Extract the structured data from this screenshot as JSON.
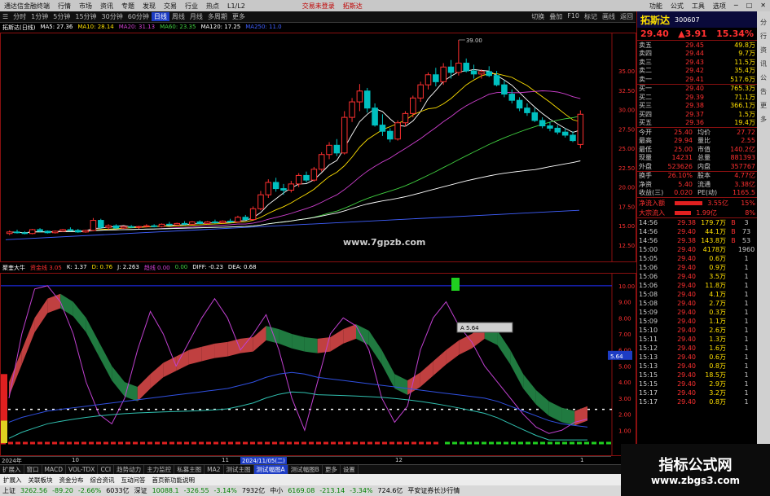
{
  "titlebar": {
    "app": "通达信金融终端",
    "menus": [
      "行情",
      "市场",
      "资讯",
      "专题",
      "发现",
      "交易",
      "行业",
      "热点",
      "L1/L2"
    ],
    "center_left": "交易未登录",
    "center_right": "拓斯达",
    "right": [
      "功能",
      "公式",
      "工具",
      "选项"
    ]
  },
  "toolbar": {
    "items": [
      "分时",
      "1分钟",
      "5分钟",
      "15分钟",
      "30分钟",
      "60分钟",
      "日线",
      "周线",
      "月线",
      "多周期",
      "更多"
    ],
    "active_index": 6,
    "right": [
      "切换",
      "叠加",
      "F10",
      "标记",
      "画线",
      "返回"
    ]
  },
  "ma_legend": [
    {
      "text": "拓斯达(日线)",
      "color": "#ffffff"
    },
    {
      "text": "MA5: 27.36",
      "color": "#ffffff"
    },
    {
      "text": "MA10: 28.14",
      "color": "#ffe000"
    },
    {
      "text": "MA20: 31.13",
      "color": "#d040d0"
    },
    {
      "text": "MA60: 23.35",
      "color": "#40d040"
    },
    {
      "text": "MA120: 17.25",
      "color": "#ffffff"
    },
    {
      "text": "MA250: 11.0",
      "color": "#4060ff"
    }
  ],
  "main_axis": [
    "35.00",
    "32.50",
    "30.00",
    "27.50",
    "25.00",
    "22.50",
    "20.00",
    "17.50",
    "15.00",
    "12.50"
  ],
  "high_label": "39.00",
  "watermark": "www.7gpzb.com",
  "indicator_legend": [
    {
      "text": "聚奎大牛",
      "color": "#ffffff"
    },
    {
      "text": "资金线 3.05",
      "color": "#ff3030"
    },
    {
      "text": "K: 1.37",
      "color": "#ffffff"
    },
    {
      "text": "D: 0.76",
      "color": "#ffe000"
    },
    {
      "text": "J: 2.263",
      "color": "#ffffff"
    },
    {
      "text": "趋线 0.00",
      "color": "#d040d0"
    },
    {
      "text": "0.00",
      "color": "#40d040"
    },
    {
      "text": "DIFF: -0.23",
      "color": "#ffffff"
    },
    {
      "text": "DEA: 0.68",
      "color": "#ffffff"
    }
  ],
  "ind_axis": [
    "10.00",
    "9.00",
    "8.00",
    "7.00",
    "6.00",
    "5.00",
    "4.00",
    "3.00",
    "2.00",
    "1.00"
  ],
  "ind_marker": "5.64",
  "tooltip": "A 5.64",
  "dates": [
    {
      "text": "2024年"
    },
    {
      "text": "10"
    },
    {
      "text": "11"
    },
    {
      "text": "2024/11/05(二)"
    },
    {
      "text": "12"
    },
    {
      "text": "1"
    }
  ],
  "panel": {
    "name": "拓斯达",
    "code": "300607",
    "price": "29.40",
    "change": "▲3.91",
    "pct": "15.34%",
    "asks": [
      {
        "l": "卖五",
        "p": "29.45",
        "v": "49.8万"
      },
      {
        "l": "卖四",
        "p": "29.44",
        "v": "9.7万"
      },
      {
        "l": "卖三",
        "p": "29.43",
        "v": "11.5万"
      },
      {
        "l": "卖二",
        "p": "29.42",
        "v": "35.4万"
      },
      {
        "l": "卖一",
        "p": "29.41",
        "v": "517.6万"
      }
    ],
    "bids": [
      {
        "l": "买一",
        "p": "29.40",
        "v": "765.3万"
      },
      {
        "l": "买二",
        "p": "29.39",
        "v": "71.1万"
      },
      {
        "l": "买三",
        "p": "29.38",
        "v": "366.1万"
      },
      {
        "l": "买四",
        "p": "29.37",
        "v": "1.5万"
      },
      {
        "l": "买五",
        "p": "29.36",
        "v": "19.4万"
      }
    ],
    "stats": [
      {
        "a": "今开",
        "b": "25.40",
        "c": "均价",
        "d": "27.72"
      },
      {
        "a": "最高",
        "b": "29.94",
        "c": "量比",
        "d": "2.55"
      },
      {
        "a": "最低",
        "b": "25.00",
        "c": "市值",
        "d": "140.2亿"
      },
      {
        "a": "现量",
        "b": "14231",
        "c": "总量",
        "d": "881393"
      },
      {
        "a": "外盘",
        "b": "523626",
        "c": "内盘",
        "d": "357767"
      }
    ],
    "stats2": [
      {
        "a": "换手",
        "b": "26.10%",
        "c": "股本",
        "d": "4.77亿"
      },
      {
        "a": "净资",
        "b": "5.40",
        "c": "流通",
        "d": "3.38亿"
      },
      {
        "a": "收益(三)",
        "b": "0.020",
        "c": "PE(动)",
        "d": "1165.5"
      }
    ],
    "flow": [
      {
        "l": "净流入额",
        "v": "3.55亿",
        "p": "15%",
        "w": 34
      },
      {
        "l": "大宗流入",
        "v": "1.99亿",
        "p": "8%",
        "w": 20
      }
    ],
    "ticks": [
      {
        "t": "14:56",
        "p": "29.38",
        "v": "179.7万",
        "f": "B",
        "n": "3"
      },
      {
        "t": "14:56",
        "p": "29.40",
        "v": "44.1万",
        "f": "B",
        "n": "73"
      },
      {
        "t": "14:56",
        "p": "29.38",
        "v": "143.8万",
        "f": "B",
        "n": "53"
      },
      {
        "t": "15:00",
        "p": "29.40",
        "v": "4178万",
        "f": "",
        "n": "1960"
      },
      {
        "t": "15:05",
        "p": "29.40",
        "v": "0.6万",
        "f": "",
        "n": "1"
      },
      {
        "t": "15:06",
        "p": "29.40",
        "v": "0.9万",
        "f": "",
        "n": "1"
      },
      {
        "t": "15:06",
        "p": "29.40",
        "v": "3.5万",
        "f": "",
        "n": "1"
      },
      {
        "t": "15:06",
        "p": "29.40",
        "v": "11.8万",
        "f": "",
        "n": "1"
      },
      {
        "t": "15:08",
        "p": "29.40",
        "v": "4.1万",
        "f": "",
        "n": "1"
      },
      {
        "t": "15:08",
        "p": "29.40",
        "v": "2.7万",
        "f": "",
        "n": "1"
      },
      {
        "t": "15:09",
        "p": "29.40",
        "v": "0.3万",
        "f": "",
        "n": "1"
      },
      {
        "t": "15:09",
        "p": "29.40",
        "v": "1.1万",
        "f": "",
        "n": "1"
      },
      {
        "t": "15:10",
        "p": "29.40",
        "v": "2.6万",
        "f": "",
        "n": "1"
      },
      {
        "t": "15:11",
        "p": "29.40",
        "v": "1.3万",
        "f": "",
        "n": "1"
      },
      {
        "t": "15:12",
        "p": "29.40",
        "v": "1.6万",
        "f": "",
        "n": "1"
      },
      {
        "t": "15:13",
        "p": "29.40",
        "v": "0.6万",
        "f": "",
        "n": "1"
      },
      {
        "t": "15:13",
        "p": "29.40",
        "v": "0.8万",
        "f": "",
        "n": "1"
      },
      {
        "t": "15:15",
        "p": "29.40",
        "v": "18.5万",
        "f": "",
        "n": "1"
      },
      {
        "t": "15:15",
        "p": "29.40",
        "v": "2.9万",
        "f": "",
        "n": "1"
      },
      {
        "t": "15:17",
        "p": "29.40",
        "v": "3.2万",
        "f": "",
        "n": "1"
      },
      {
        "t": "15:17",
        "p": "29.40",
        "v": "0.8万",
        "f": "",
        "n": "1"
      }
    ]
  },
  "sidebar": [
    "分",
    "行",
    "资",
    "讯",
    "公",
    "告",
    "更",
    "多"
  ],
  "tabs": [
    "扩展入",
    "窗口",
    "MACD",
    "VOL-TDX",
    "CCI",
    "趋势动力",
    "主力监控",
    "私募主图",
    "MA2",
    "测试主图",
    "测试幅图A",
    "测试幅图B",
    "更多",
    "设置"
  ],
  "tabs_active": 10,
  "infobar": [
    "扩展入",
    "关联板块",
    "资金分布",
    "综合资讯",
    "互动问答",
    "首页新功能说明"
  ],
  "statusbar": [
    {
      "text": "上证",
      "cls": ""
    },
    {
      "text": "3262.56",
      "cls": "dn"
    },
    {
      "text": "-89.20",
      "cls": "dn"
    },
    {
      "text": "-2.66%",
      "cls": "dn"
    },
    {
      "text": "6033亿",
      "cls": ""
    },
    {
      "text": "深证",
      "cls": ""
    },
    {
      "text": "10088.1",
      "cls": "dn"
    },
    {
      "text": "-326.55",
      "cls": "dn"
    },
    {
      "text": "-3.14%",
      "cls": "dn"
    },
    {
      "text": "7932亿",
      "cls": ""
    },
    {
      "text": "中小",
      "cls": ""
    },
    {
      "text": "6169.08",
      "cls": "dn"
    },
    {
      "text": "-213.14",
      "cls": "dn"
    },
    {
      "text": "-3.34%",
      "cls": "dn"
    },
    {
      "text": "724.6亿",
      "cls": ""
    },
    {
      "text": "平安证券长沙行情",
      "cls": ""
    }
  ],
  "brand": {
    "line1": "指标公式网",
    "line2": "www.zbgs3.com"
  },
  "colors": {
    "up": "#ff3030",
    "down": "#00c0c0",
    "ma5": "#ffffff",
    "ma10": "#ffe000",
    "ma20": "#d040d0",
    "ma60": "#40d040",
    "ma120": "#ffffff",
    "ma250": "#4060ff"
  },
  "chart_data": {
    "type": "candlestick",
    "ylim": [
      12.5,
      39
    ],
    "candles": [
      [
        14.0,
        14.4,
        13.8,
        14.2
      ],
      [
        14.2,
        14.5,
        14.0,
        14.1
      ],
      [
        14.1,
        14.3,
        13.9,
        14.0
      ],
      [
        14.0,
        14.6,
        13.9,
        14.5
      ],
      [
        14.5,
        14.7,
        14.2,
        14.3
      ],
      [
        14.3,
        14.4,
        14.0,
        14.1
      ],
      [
        14.1,
        14.4,
        14.0,
        14.3
      ],
      [
        14.3,
        14.6,
        14.2,
        14.5
      ],
      [
        14.5,
        14.8,
        14.3,
        14.4
      ],
      [
        14.4,
        14.6,
        14.1,
        14.2
      ],
      [
        14.2,
        14.5,
        14.1,
        14.4
      ],
      [
        14.4,
        16.0,
        14.3,
        15.7
      ],
      [
        15.7,
        15.9,
        14.6,
        14.8
      ],
      [
        14.8,
        15.2,
        14.5,
        15.0
      ],
      [
        15.0,
        15.2,
        14.6,
        14.7
      ],
      [
        14.7,
        15.0,
        14.6,
        14.9
      ],
      [
        14.9,
        15.1,
        14.7,
        14.8
      ],
      [
        14.8,
        15.0,
        14.6,
        14.9
      ],
      [
        14.9,
        15.2,
        14.8,
        15.0
      ],
      [
        15.0,
        15.2,
        14.8,
        14.9
      ],
      [
        14.9,
        15.3,
        14.8,
        15.2
      ],
      [
        15.2,
        15.5,
        15.0,
        15.1
      ],
      [
        15.1,
        15.4,
        15.0,
        15.3
      ],
      [
        15.3,
        15.6,
        15.1,
        15.2
      ],
      [
        15.2,
        15.6,
        15.1,
        15.5
      ],
      [
        15.5,
        15.7,
        15.2,
        15.3
      ],
      [
        15.3,
        15.6,
        15.2,
        15.5
      ],
      [
        15.5,
        15.8,
        15.3,
        15.4
      ],
      [
        15.4,
        15.7,
        15.3,
        15.6
      ],
      [
        15.6,
        15.9,
        15.4,
        15.5
      ],
      [
        15.5,
        16.3,
        15.4,
        16.1
      ],
      [
        16.1,
        16.4,
        15.7,
        15.8
      ],
      [
        15.8,
        17.5,
        15.7,
        17.2
      ],
      [
        17.2,
        19.5,
        17.0,
        19.0
      ],
      [
        19.0,
        21.0,
        18.6,
        20.6
      ],
      [
        20.6,
        21.2,
        19.4,
        19.8
      ],
      [
        19.8,
        20.4,
        19.0,
        19.6
      ],
      [
        19.6,
        20.8,
        19.3,
        20.4
      ],
      [
        20.4,
        21.8,
        20.0,
        21.5
      ],
      [
        21.5,
        22.0,
        20.6,
        20.9
      ],
      [
        20.9,
        22.6,
        20.7,
        22.3
      ],
      [
        22.3,
        24.5,
        22.0,
        24.2
      ],
      [
        24.2,
        25.8,
        23.6,
        25.4
      ],
      [
        25.4,
        26.2,
        24.0,
        24.4
      ],
      [
        24.4,
        29.8,
        24.2,
        29.0
      ],
      [
        29.0,
        31.5,
        28.4,
        31.0
      ],
      [
        31.0,
        33.3,
        29.8,
        32.4
      ],
      [
        32.4,
        32.8,
        29.6,
        30.2
      ],
      [
        30.2,
        30.8,
        27.8,
        28.0
      ],
      [
        28.0,
        29.4,
        26.6,
        27.2
      ],
      [
        27.2,
        27.6,
        25.8,
        26.2
      ],
      [
        26.2,
        28.6,
        26.0,
        28.3
      ],
      [
        28.3,
        29.8,
        27.8,
        29.5
      ],
      [
        29.5,
        31.8,
        29.0,
        31.5
      ],
      [
        31.5,
        33.6,
        31.0,
        33.2
      ],
      [
        33.2,
        34.8,
        32.6,
        34.5
      ],
      [
        34.5,
        35.4,
        33.0,
        33.6
      ],
      [
        33.6,
        36.0,
        33.2,
        35.5
      ],
      [
        35.5,
        36.4,
        34.0,
        34.8
      ],
      [
        34.8,
        39.0,
        34.4,
        36.0
      ],
      [
        36.0,
        36.6,
        34.8,
        35.0
      ],
      [
        35.0,
        35.8,
        34.0,
        34.6
      ],
      [
        34.6,
        35.2,
        34.0,
        34.9
      ],
      [
        34.9,
        35.6,
        34.2,
        34.4
      ],
      [
        34.4,
        35.0,
        33.0,
        33.2
      ],
      [
        33.2,
        33.8,
        31.6,
        32.0
      ],
      [
        32.0,
        32.6,
        30.8,
        31.2
      ],
      [
        31.2,
        31.6,
        29.8,
        30.2
      ],
      [
        30.2,
        30.8,
        29.2,
        29.6
      ],
      [
        29.6,
        30.2,
        28.4,
        28.6
      ],
      [
        28.6,
        29.0,
        27.6,
        27.9
      ],
      [
        27.9,
        28.4,
        27.2,
        27.6
      ],
      [
        27.6,
        28.0,
        26.8,
        27.1
      ],
      [
        27.1,
        27.6,
        26.4,
        26.7
      ],
      [
        26.7,
        27.2,
        25.8,
        26.0
      ],
      [
        25.5,
        29.9,
        25.0,
        29.4
      ]
    ]
  }
}
